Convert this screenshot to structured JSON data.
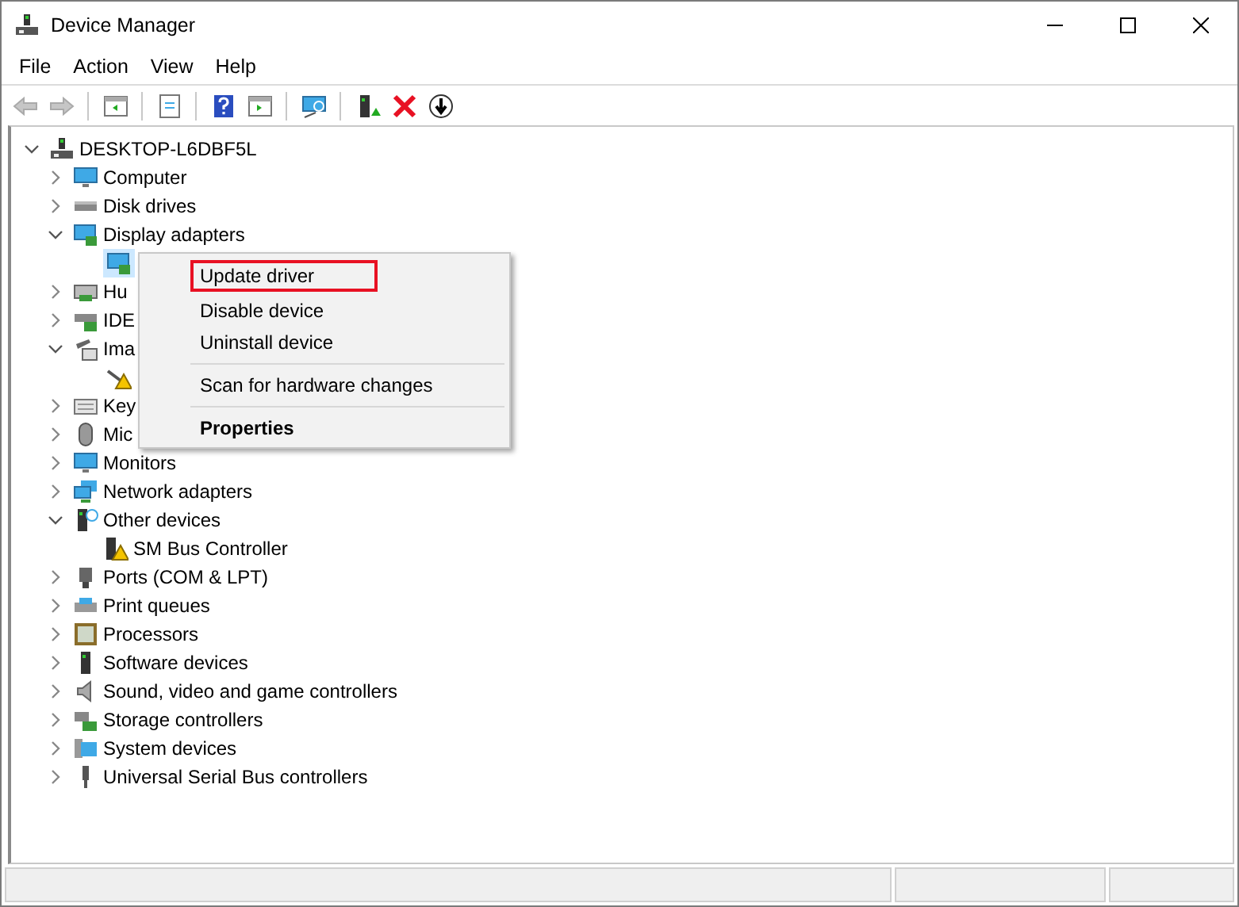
{
  "window": {
    "title": "Device Manager"
  },
  "menu": [
    "File",
    "Action",
    "View",
    "Help"
  ],
  "toolbar": [
    {
      "disabled": true
    },
    {
      "disabled": true
    },
    {
      "disabled": false
    },
    {
      "disabled": false
    },
    {
      "disabled": false
    },
    {
      "disabled": false
    },
    {
      "disabled": false
    },
    {
      "disabled": false
    },
    {
      "disabled": false
    },
    {
      "disabled": false
    }
  ],
  "tree": {
    "label": "DESKTOP-L6DBF5L",
    "expanded": true,
    "children": [
      {
        "label": "Computer",
        "expanded": false
      },
      {
        "label": "Disk drives",
        "expanded": false
      },
      {
        "label": "Display adapters",
        "expanded": true,
        "children": [
          {
            "selected": true
          }
        ]
      },
      {
        "label": "Hu",
        "expanded": false
      },
      {
        "label": "IDE",
        "expanded": false
      },
      {
        "label": "Ima",
        "expanded": true,
        "children": [
          {
            "selected": false
          }
        ]
      },
      {
        "label": "Key",
        "expanded": false
      },
      {
        "label": "Mic",
        "expanded": false
      },
      {
        "label": "Monitors",
        "expanded": false
      },
      {
        "label": "Network adapters",
        "expanded": false
      },
      {
        "label": "Other devices",
        "expanded": true,
        "children": [
          {
            "label": "SM Bus Controller",
            "selected": false
          }
        ]
      },
      {
        "label": "Ports (COM & LPT)",
        "expanded": false
      },
      {
        "label": "Print queues",
        "expanded": false
      },
      {
        "label": "Processors",
        "expanded": false
      },
      {
        "label": "Software devices",
        "expanded": false
      },
      {
        "label": "Sound, video and game controllers",
        "expanded": false
      },
      {
        "label": "Storage controllers",
        "expanded": false
      },
      {
        "label": "System devices",
        "expanded": false
      },
      {
        "label": "Universal Serial Bus controllers",
        "expanded": false
      }
    ]
  },
  "context_menu": [
    {
      "label": "Update driver",
      "highlighted": true,
      "bold": false,
      "separator_after": false
    },
    {
      "label": "Disable device",
      "highlighted": false,
      "bold": false,
      "separator_after": false
    },
    {
      "label": "Uninstall device",
      "highlighted": false,
      "bold": false,
      "separator_after": true
    },
    {
      "label": "Scan for hardware changes",
      "highlighted": false,
      "bold": false,
      "separator_after": true
    },
    {
      "label": "Properties",
      "highlighted": false,
      "bold": true,
      "separator_after": false
    }
  ]
}
